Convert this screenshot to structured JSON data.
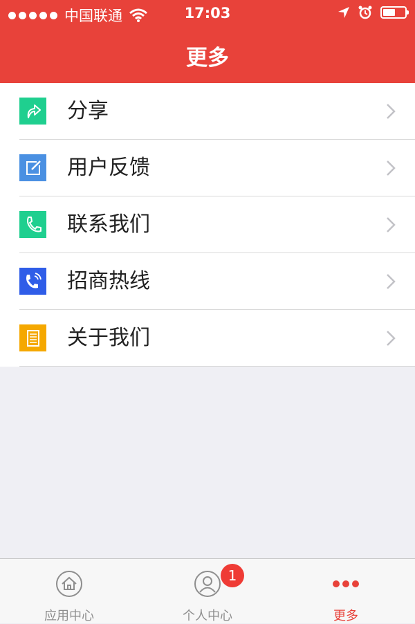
{
  "status_bar": {
    "carrier": "中国联通",
    "time": "17:03",
    "battery_level": 0.56
  },
  "header": {
    "title": "更多"
  },
  "menu": {
    "items": [
      {
        "label": "分享",
        "icon": "share-icon",
        "color": "#1fcf8f"
      },
      {
        "label": "用户反馈",
        "icon": "feedback-edit-icon",
        "color": "#4a90e2"
      },
      {
        "label": "联系我们",
        "icon": "phone-icon",
        "color": "#1fcf8f"
      },
      {
        "label": "招商热线",
        "icon": "phone-call-icon",
        "color": "#2f5de8"
      },
      {
        "label": "关于我们",
        "icon": "document-icon",
        "color": "#f5a800"
      }
    ]
  },
  "tabbar": {
    "tabs": [
      {
        "label": "应用中心",
        "icon": "home-icon",
        "active": false
      },
      {
        "label": "个人中心",
        "icon": "user-icon",
        "active": false,
        "badge": "1"
      },
      {
        "label": "更多",
        "icon": "more-dots-icon",
        "active": true
      }
    ]
  },
  "colors": {
    "accent": "#e8423a",
    "background": "#efeff4"
  }
}
